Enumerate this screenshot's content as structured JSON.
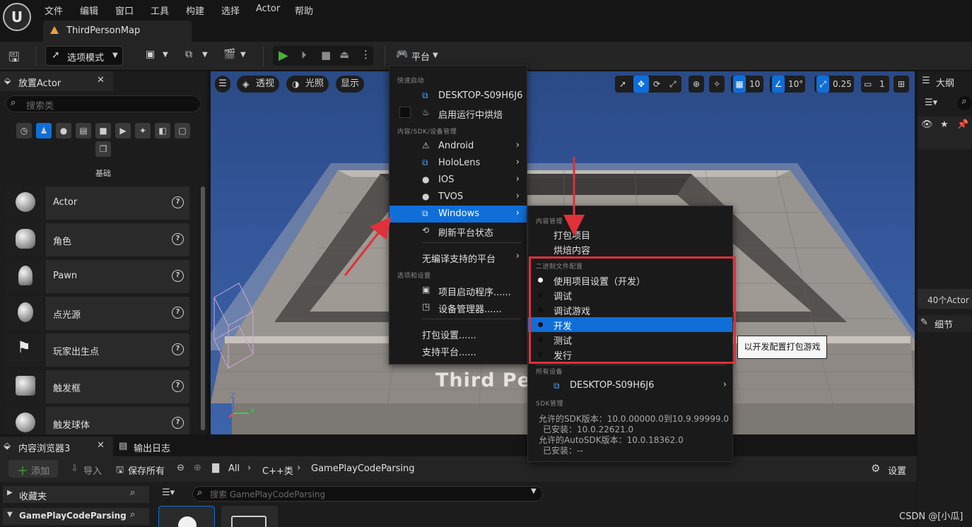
{
  "menubar": {
    "items": [
      "文件",
      "编辑",
      "窗口",
      "工具",
      "构建",
      "选择",
      "Actor",
      "帮助"
    ]
  },
  "logo_text": "U",
  "map_tab": {
    "label": "ThirdPersonMap"
  },
  "toolbar": {
    "mode_label": "选项模式",
    "platform_label": "平台"
  },
  "place_panel": {
    "title": "放置Actor",
    "search_placeholder": "搜索类",
    "category_label": "基础",
    "actors": [
      "Actor",
      "角色",
      "Pawn",
      "点光源",
      "玩家出生点",
      "触发框",
      "触发球体"
    ],
    "help_glyph": "?"
  },
  "viewport": {
    "pills": [
      "透视",
      "光照",
      "显示"
    ],
    "grid_value": "10",
    "angle_value": "10°",
    "scale_value": "0.25",
    "camera_value": "1",
    "floor_text": "Third Pe",
    "axis_z": "Z",
    "axis_y": "Y"
  },
  "outline": {
    "title": "大纲",
    "actor_count": "40个Actor",
    "details_title": "细节"
  },
  "platform_menu": {
    "section_quick": "快速启动",
    "device": "DESKTOP-S09H6J6",
    "bake_label": "启用运行中烘焙",
    "section_content": "内容/SDK/设备管理",
    "platforms": [
      "Android",
      "HoloLens",
      "IOS",
      "TVOS",
      "Windows"
    ],
    "refresh_label": "刷新平台状态",
    "no_compile_label": "无编译支持的平台",
    "section_options": "选项和设置",
    "launcher_label": "项目启动程序......",
    "device_mgr_label": "设备管理器......",
    "pack_settings_label": "打包设置......",
    "support_label": "支持平台......"
  },
  "windows_menu": {
    "section_content": "内容管理",
    "package_label": "打包项目",
    "cook_label": "烘焙内容",
    "section_binary": "二进制文件配置",
    "configs": [
      "使用项目设置（开发）",
      "调试",
      "调试游戏",
      "开发",
      "测试",
      "发行"
    ],
    "selected_index": 0,
    "highlighted_index": 3,
    "section_devices": "所有设备",
    "device": "DESKTOP-S09H6J6",
    "section_sdk": "SDK管理",
    "sdk_allowed": "允许的SDK版本：10.0.00000.0到10.9.99999.0",
    "sdk_installed": "已安装：10.0.22621.0",
    "autosdk_allowed": "允许的AutoSDK版本：10.0.18362.0",
    "autosdk_installed": "已安装：--"
  },
  "tooltip": "以开发配置打包游戏",
  "content_browser": {
    "tab_label": "内容浏览器3",
    "log_tab_label": "输出日志",
    "add_label": "添加",
    "import_label": "导入",
    "save_all_label": "保存所有",
    "crumbs": [
      "All",
      "C++类",
      "GamePlayCodeParsing"
    ],
    "settings_label": "设置",
    "favorites_label": "收藏夹",
    "root_label": "GamePlayCodeParsing",
    "search_placeholder": "搜索 GamePlayCodeParsing"
  },
  "watermark": "CSDN @[小瓜]",
  "colors": {
    "highlight": "#0f6ed8",
    "annotation_red": "#e0303a",
    "play_green": "#4caf3c"
  }
}
